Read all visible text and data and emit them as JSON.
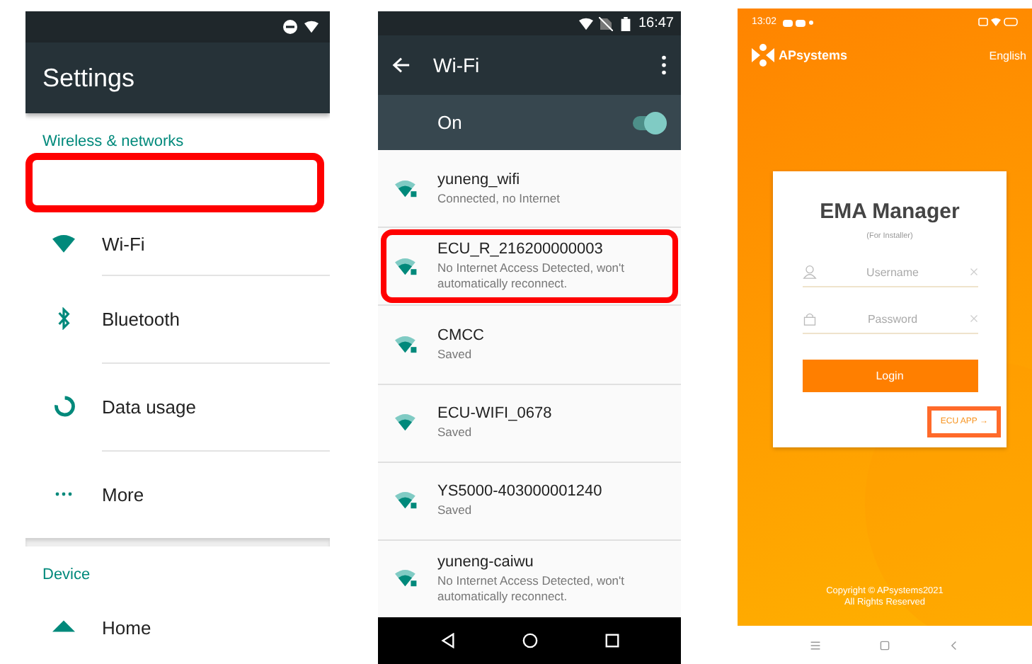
{
  "settings": {
    "title": "Settings",
    "sections": [
      {
        "header": "Wireless & networks",
        "items": [
          {
            "kind": "wifi",
            "label": "Wi-Fi"
          },
          {
            "kind": "bluetooth",
            "label": "Bluetooth"
          },
          {
            "kind": "data",
            "label": "Data usage"
          },
          {
            "kind": "more",
            "label": "More"
          }
        ]
      },
      {
        "header": "Device",
        "items": [
          {
            "kind": "home",
            "label": "Home"
          }
        ]
      }
    ]
  },
  "wifi": {
    "time": "16:47",
    "title": "Wi-Fi",
    "switch": {
      "label": "On",
      "on": true
    },
    "networks": [
      {
        "name": "yuneng_wifi",
        "status": "Connected, no Internet",
        "locked": true,
        "highlighted": false
      },
      {
        "name": "ECU_R_216200000003",
        "status": "No Internet Access Detected, won't automatically reconnect.",
        "locked": true,
        "highlighted": true
      },
      {
        "name": "CMCC",
        "status": "Saved",
        "locked": true,
        "highlighted": false
      },
      {
        "name": "ECU-WIFI_0678",
        "status": "Saved",
        "locked": false,
        "highlighted": false
      },
      {
        "name": "YS5000-403000001240",
        "status": "Saved",
        "locked": true,
        "highlighted": false
      },
      {
        "name": "yuneng-caiwu",
        "status": "No Internet Access Detected, won't automatically reconnect.",
        "locked": true,
        "highlighted": false
      }
    ]
  },
  "login": {
    "time": "13:02",
    "brand": "APsystems",
    "language": "English",
    "title": "EMA Manager",
    "subtitle": "(For Installer)",
    "fields": [
      {
        "kind": "user",
        "placeholder": "Username"
      },
      {
        "kind": "lock",
        "placeholder": "Password"
      }
    ],
    "button": "Login",
    "link": "ECU APP →",
    "copyright": [
      "Copyright © APsystems2021",
      "All Rights Reserved"
    ]
  }
}
